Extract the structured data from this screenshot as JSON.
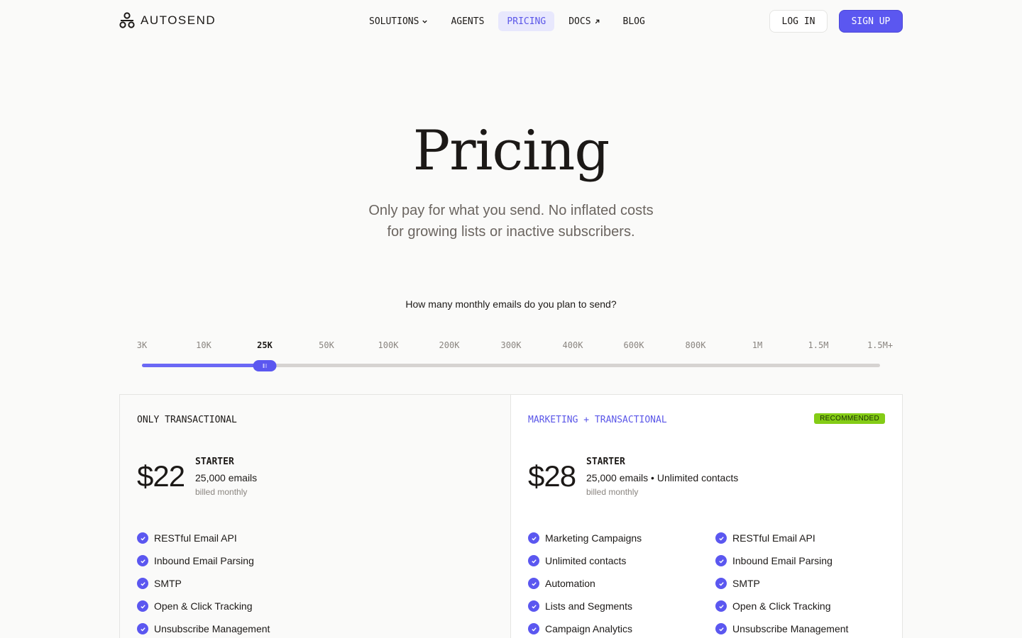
{
  "nav": {
    "logo_text": "AUTOSEND",
    "links": [
      {
        "label": "SOLUTIONS"
      },
      {
        "label": "AGENTS"
      },
      {
        "label": "PRICING"
      },
      {
        "label": "DOCS"
      },
      {
        "label": "BLOG"
      }
    ],
    "login_label": "LOG IN",
    "signup_label": "SIGN UP"
  },
  "hero": {
    "title": "Pricing",
    "subtitle_line1": "Only pay for what you send. No inflated costs",
    "subtitle_line2": "for growing lists or inactive subscribers."
  },
  "slider": {
    "question": "How many monthly emails do you plan to send?",
    "ticks": [
      "3K",
      "10K",
      "25K",
      "50K",
      "100K",
      "200K",
      "300K",
      "400K",
      "600K",
      "800K",
      "1M",
      "1.5M",
      "1.5M+"
    ],
    "selected_index": 2
  },
  "plans": {
    "transactional": {
      "label": "ONLY TRANSACTIONAL",
      "price": "$22",
      "plan_name": "STARTER",
      "description": "25,000 emails",
      "billing": "billed monthly",
      "features": [
        "RESTful Email API",
        "Inbound Email Parsing",
        "SMTP",
        "Open & Click Tracking",
        "Unsubscribe Management"
      ]
    },
    "marketing": {
      "label": "MARKETING + TRANSACTIONAL",
      "badge": "RECOMMENDED",
      "price": "$28",
      "plan_name": "STARTER",
      "description": "25,000 emails • Unlimited contacts",
      "billing": "billed monthly",
      "features_col1": [
        "Marketing Campaigns",
        "Unlimited contacts",
        "Automation",
        "Lists and Segments",
        "Campaign Analytics"
      ],
      "features_col2": [
        "RESTful Email API",
        "Inbound Email Parsing",
        "SMTP",
        "Open & Click Tracking",
        "Unsubscribe Management"
      ]
    }
  },
  "colors": {
    "accent": "#5b57f0",
    "badge": "#84cc16",
    "background": "#fafaf9"
  }
}
